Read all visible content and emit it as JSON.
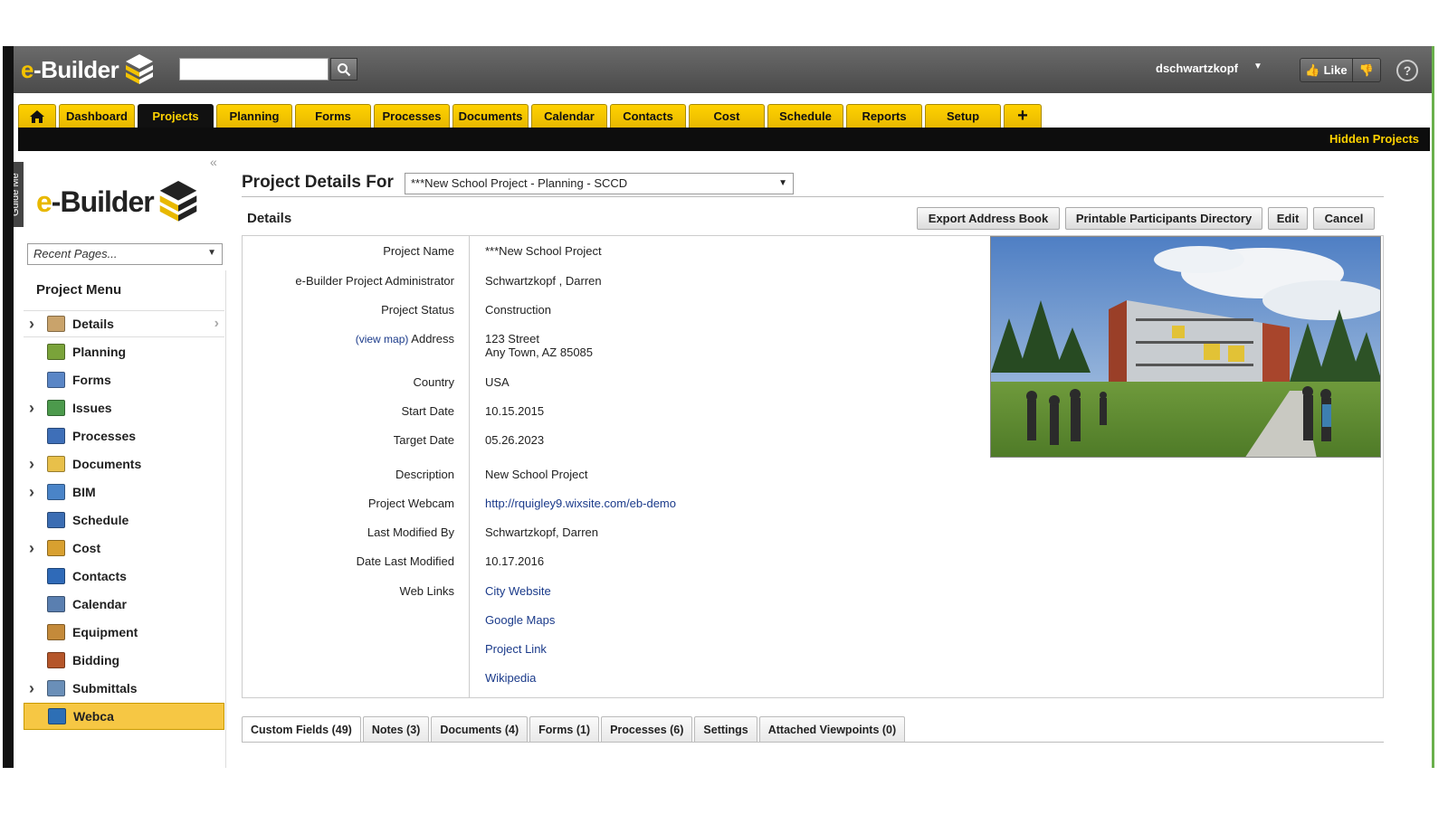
{
  "header": {
    "brand": "e-Builder",
    "search_placeholder": "",
    "user": "dschwartzkopf",
    "like_label": "Like",
    "help_label": "?"
  },
  "nav": {
    "tabs": [
      "Dashboard",
      "Projects",
      "Planning",
      "Forms",
      "Processes",
      "Documents",
      "Calendar",
      "Contacts",
      "Cost",
      "Schedule",
      "Reports",
      "Setup"
    ],
    "active": "Projects",
    "plus_label": "+",
    "hidden_projects": "Hidden Projects"
  },
  "sidebar": {
    "guide_me": "Guide Me",
    "collapse": "«",
    "recent_pages": "Recent Pages...",
    "menu_title": "Project Menu",
    "items": [
      {
        "label": "Details",
        "expandable": true,
        "icon": "details-icon",
        "color": "#c9a36b"
      },
      {
        "label": "Planning",
        "expandable": false,
        "icon": "planning-icon",
        "color": "#7aa33a"
      },
      {
        "label": "Forms",
        "expandable": false,
        "icon": "forms-icon",
        "color": "#5a86c6"
      },
      {
        "label": "Issues",
        "expandable": true,
        "icon": "issues-icon",
        "color": "#4c9a4c"
      },
      {
        "label": "Processes",
        "expandable": false,
        "icon": "processes-icon",
        "color": "#3e6fb8"
      },
      {
        "label": "Documents",
        "expandable": true,
        "icon": "folder-icon",
        "color": "#e8c04a"
      },
      {
        "label": "BIM",
        "expandable": true,
        "icon": "bim-cube-icon",
        "color": "#4a84c8"
      },
      {
        "label": "Schedule",
        "expandable": false,
        "icon": "schedule-icon",
        "color": "#3b6db3"
      },
      {
        "label": "Cost",
        "expandable": true,
        "icon": "cost-icon",
        "color": "#d8a030"
      },
      {
        "label": "Contacts",
        "expandable": false,
        "icon": "contacts-book-icon",
        "color": "#2f6ab8"
      },
      {
        "label": "Calendar",
        "expandable": false,
        "icon": "calendar-icon",
        "color": "#5a7fb0"
      },
      {
        "label": "Equipment",
        "expandable": false,
        "icon": "equipment-icon",
        "color": "#c48a3a"
      },
      {
        "label": "Bidding",
        "expandable": false,
        "icon": "gavel-icon",
        "color": "#b5562a"
      },
      {
        "label": "Submittals",
        "expandable": true,
        "icon": "submittals-icon",
        "color": "#6a8fb8"
      },
      {
        "label": "Webcam",
        "expandable": false,
        "icon": "webcam-icon",
        "color": "#2d6fb5"
      }
    ],
    "active_item_display": "Webca"
  },
  "main": {
    "title": "Project Details For",
    "project_select": "***New School Project - Planning - SCCD",
    "details_heading": "Details",
    "buttons": {
      "export": "Export Address Book",
      "printable": "Printable Participants Directory",
      "edit": "Edit",
      "cancel": "Cancel"
    },
    "fields": {
      "project_name_label": "Project Name",
      "project_name": "***New School Project",
      "admin_label": "e-Builder Project Administrator",
      "admin": "Schwartzkopf , Darren",
      "status_label": "Project Status",
      "status": "Construction",
      "view_map": "(view map)",
      "address_label": "Address",
      "address_line1": "123 Street",
      "address_line2": "Any Town, AZ 85085",
      "country_label": "Country",
      "country": "USA",
      "start_label": "Start Date",
      "start": "10.15.2015",
      "target_label": "Target Date",
      "target": "05.26.2023",
      "description_label": "Description",
      "description": "New School Project",
      "webcam_label": "Project Webcam",
      "webcam": "http://rquigley9.wixsite.com/eb-demo",
      "modified_by_label": "Last Modified By",
      "modified_by": "Schwartzkopf, Darren",
      "date_modified_label": "Date Last Modified",
      "date_modified": "10.17.2016",
      "web_links_label": "Web Links",
      "web_links": [
        "City Website",
        "Google Maps",
        "Project Link",
        "Wikipedia"
      ]
    },
    "bottom_tabs": [
      "Custom Fields (49)",
      "Notes (3)",
      "Documents (4)",
      "Forms (1)",
      "Processes (6)",
      "Settings",
      "Attached Viewpoints (0)"
    ]
  },
  "colors": {
    "accent_yellow": "#ffd200",
    "link_blue": "#1a3a8a",
    "header_gray": "#555555"
  }
}
